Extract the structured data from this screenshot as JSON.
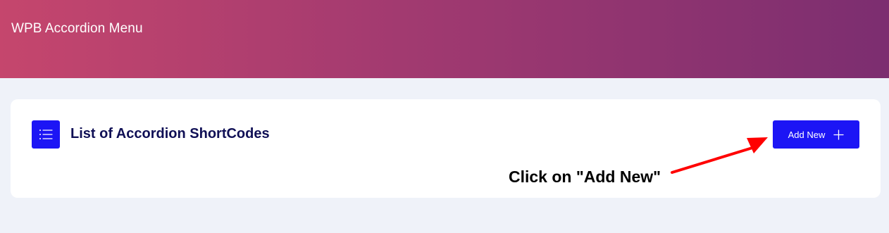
{
  "header": {
    "title": "WPB Accordion Menu"
  },
  "card": {
    "title": "List of Accordion ShortCodes",
    "icon": "list-icon",
    "add_button_label": "Add New",
    "add_button_icon": "plus-icon"
  },
  "annotation": {
    "text": "Click on \"Add New\"",
    "arrow_color": "#ff0000"
  },
  "colors": {
    "header_gradient_start": "#c5466d",
    "header_gradient_end": "#7c2e70",
    "accent": "#1c15f5",
    "title_text": "#0f0f55",
    "page_background": "#eff2f9"
  }
}
